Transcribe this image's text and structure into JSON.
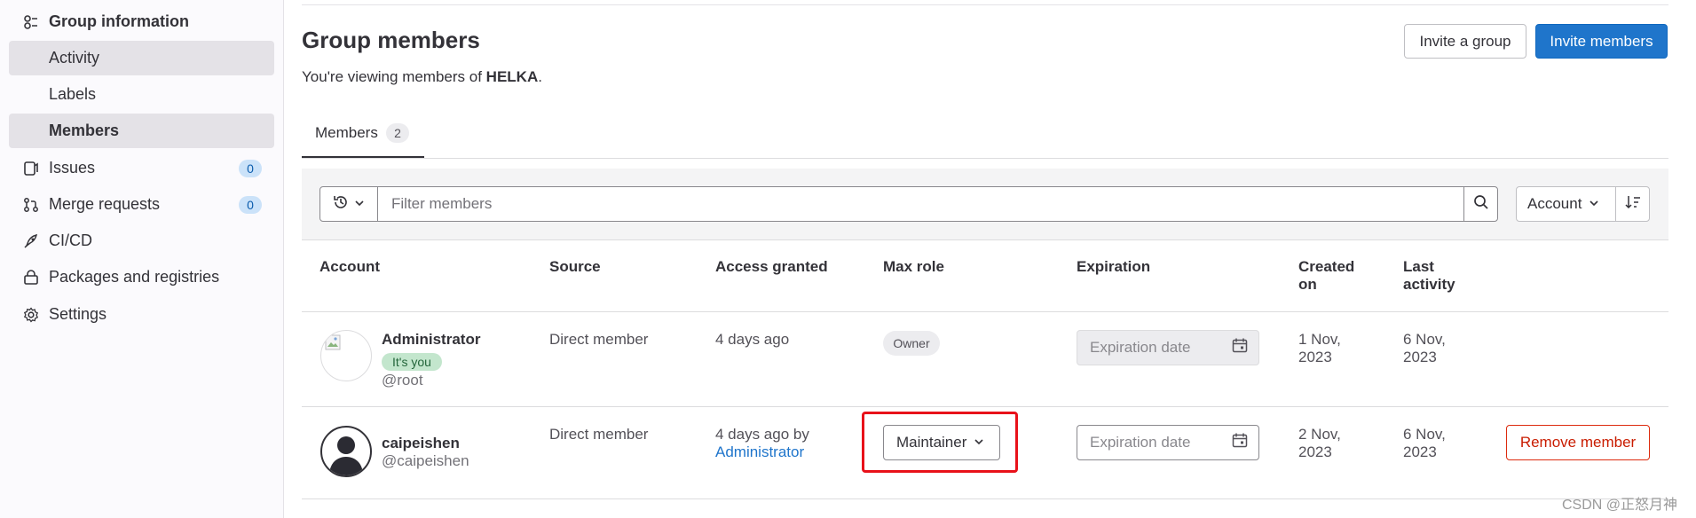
{
  "sidebar": {
    "header": {
      "label": "Group information",
      "icon": "group-icon"
    },
    "sub_items": [
      {
        "label": "Activity",
        "active": true
      },
      {
        "label": "Labels",
        "active": false
      },
      {
        "label": "Members",
        "active": true
      }
    ],
    "items": [
      {
        "label": "Issues",
        "icon": "issues-icon",
        "badge": "0"
      },
      {
        "label": "Merge requests",
        "icon": "merge-request-icon",
        "badge": "0"
      },
      {
        "label": "CI/CD",
        "icon": "rocket-icon"
      },
      {
        "label": "Packages and registries",
        "icon": "package-icon"
      },
      {
        "label": "Settings",
        "icon": "settings-icon"
      }
    ]
  },
  "header": {
    "title": "Group members",
    "subtitle_prefix": "You're viewing members of ",
    "group_name": "HELKA",
    "subtitle_suffix": ".",
    "invite_group_label": "Invite a group",
    "invite_members_label": "Invite members"
  },
  "tabs": [
    {
      "label": "Members",
      "count": "2"
    }
  ],
  "filter": {
    "placeholder": "Filter members",
    "sort_label": "Account"
  },
  "table": {
    "columns": {
      "account": "Account",
      "source": "Source",
      "access_granted": "Access granted",
      "max_role": "Max role",
      "expiration": "Expiration",
      "created_on_1": "Created",
      "created_on_2": "on",
      "last_activity_1": "Last",
      "last_activity_2": "activity"
    },
    "rows": [
      {
        "name": "Administrator",
        "badge": "It's you",
        "username": "@root",
        "source": "Direct member",
        "access_granted": "4 days ago",
        "max_role": "Owner",
        "expiration_placeholder": "Expiration date",
        "created_1": "1 Nov,",
        "created_2": "2023",
        "last_activity_1": "6 Nov,",
        "last_activity_2": "2023"
      },
      {
        "name": "caipeishen",
        "username": "@caipeishen",
        "source": "Direct member",
        "access_granted_prefix": "4 days ago by",
        "access_granted_by": "Administrator",
        "max_role": "Maintainer",
        "expiration_placeholder": "Expiration date",
        "created_1": "2 Nov,",
        "created_2": "2023",
        "last_activity_1": "6 Nov,",
        "last_activity_2": "2023",
        "remove_label": "Remove member"
      }
    ]
  },
  "watermark": "CSDN @正怒月神",
  "colors": {
    "primary": "#1f75cb",
    "danger": "#dd2b0e",
    "highlight": "#e8111a",
    "sidebar_active": "#e4e2e7"
  }
}
